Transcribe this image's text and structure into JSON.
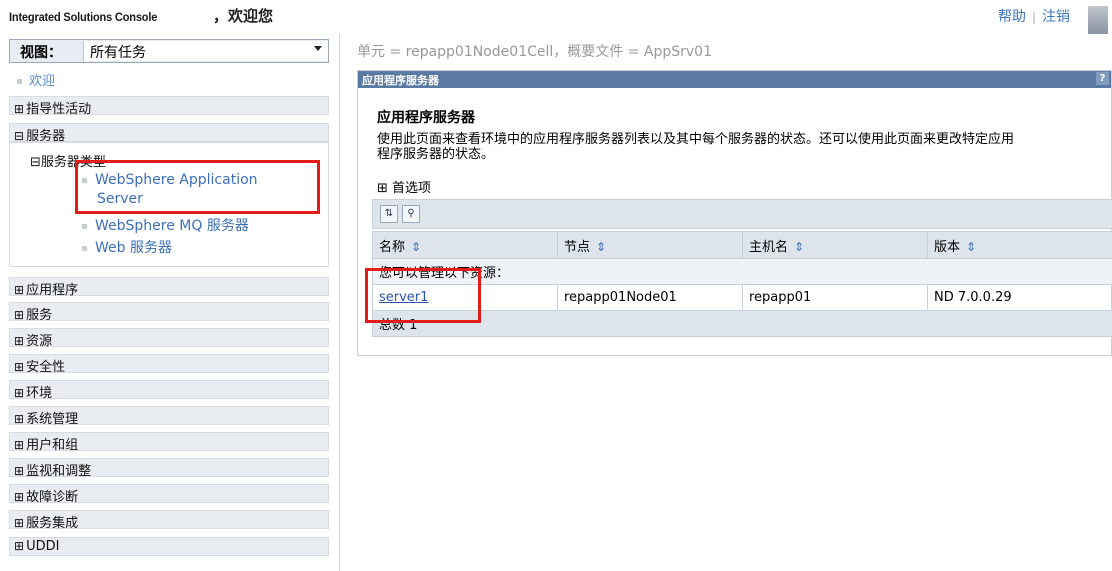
{
  "banner": {
    "brand": "Integrated Solutions Console",
    "welcome": "，欢迎您",
    "help": "帮助",
    "logout": "注销"
  },
  "nav": {
    "view_label": "视图：",
    "view_value": "所有任务",
    "welcome": "欢迎",
    "sections": [
      {
        "pm": "⊞",
        "label": "指导性活动"
      },
      {
        "pm": "⊟",
        "label": "服务器"
      },
      {
        "pm": "⊞",
        "label": "应用程序"
      },
      {
        "pm": "⊞",
        "label": "服务"
      },
      {
        "pm": "⊞",
        "label": "资源"
      },
      {
        "pm": "⊞",
        "label": "安全性"
      },
      {
        "pm": "⊞",
        "label": "环境"
      },
      {
        "pm": "⊞",
        "label": "系统管理"
      },
      {
        "pm": "⊞",
        "label": "用户和组"
      },
      {
        "pm": "⊞",
        "label": "监视和调整"
      },
      {
        "pm": "⊞",
        "label": "故障诊断"
      },
      {
        "pm": "⊞",
        "label": "服务集成"
      },
      {
        "pm": "⊞",
        "label": "UDDI"
      }
    ],
    "server_types": {
      "pm": "⊟",
      "label": "服务器类型",
      "items": [
        "WebSphere Application",
        "Server",
        "WebSphere MQ 服务器",
        "Web 服务器"
      ]
    }
  },
  "content": {
    "breadcrumb": "单元 = repapp01Node01Cell，概要文件 = AppSrv01",
    "portlet_title": "应用程序服务器",
    "help_icon_text": "?",
    "heading": "应用程序服务器",
    "description_line1": "使用此页面来查看环境中的应用程序服务器列表以及其中每个服务器的状态。还可以使用此页面来更改特定应用",
    "description_line2": "程序服务器的状态。",
    "preferences": "⊞ 首选项",
    "columns": [
      "名称",
      "节点",
      "主机名",
      "版本"
    ],
    "note": "您可以管理以下资源：",
    "rows": [
      {
        "name": "server1",
        "node": "repapp01Node01",
        "host": "repapp01",
        "version": "ND 7.0.0.29"
      }
    ],
    "total": "总数 1"
  },
  "colors": {
    "highlight": "#e41b1b",
    "link": "#2a55b0",
    "title_bar": "#5a7aa3"
  }
}
